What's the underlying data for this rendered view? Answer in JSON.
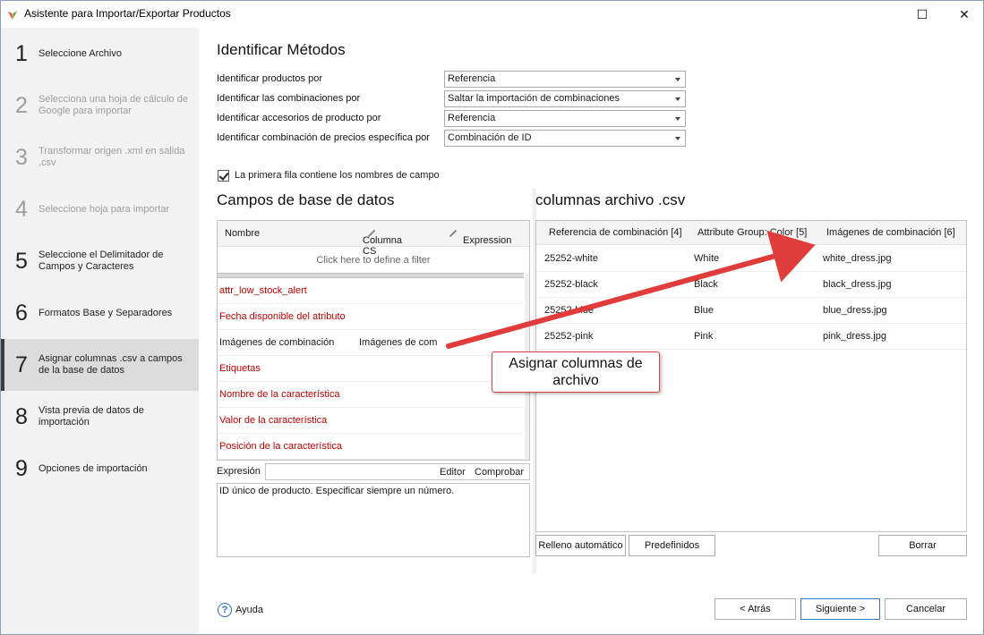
{
  "window": {
    "title": "Asistente para Importar/Exportar Productos",
    "maximize_glyph": "☐",
    "close_glyph": "✕"
  },
  "steps": [
    {
      "num": "1",
      "label": "Seleccione Archivo",
      "state": "enabled"
    },
    {
      "num": "2",
      "label": "Selecciona una hoja de cálculo de Google para importar",
      "state": "disabled"
    },
    {
      "num": "3",
      "label": "Transformar origen .xml en salida .csv",
      "state": "disabled"
    },
    {
      "num": "4",
      "label": "Seleccione hoja para importar",
      "state": "disabled"
    },
    {
      "num": "5",
      "label": "Seleccione el Delimitador de Campos y Caracteres",
      "state": "enabled"
    },
    {
      "num": "6",
      "label": "Formatos Base y Separadores",
      "state": "enabled"
    },
    {
      "num": "7",
      "label": "Asignar columnas .csv a campos de la base de datos",
      "state": "active"
    },
    {
      "num": "8",
      "label": "Vista previa de datos de importación",
      "state": "enabled"
    },
    {
      "num": "9",
      "label": "Opciones de importación",
      "state": "enabled"
    }
  ],
  "identify": {
    "title": "Identificar Métodos",
    "rows": [
      {
        "label": "Identificar productos por",
        "value": "Referencia"
      },
      {
        "label": "Identificar las combinaciones por",
        "value": "Saltar la importación de combinaciones"
      },
      {
        "label": "Identificar accesorios de producto por",
        "value": "Referencia"
      },
      {
        "label": "Identificar combinación de precios específica por",
        "value": "Combinación de ID"
      }
    ]
  },
  "first_row_checkbox": {
    "label": "La primera fila contiene los nombres de campo",
    "checked": true
  },
  "db_fields": {
    "title": "Campos de base de datos",
    "headers": {
      "name": "Nombre",
      "csv_column": "Columna CS",
      "expression": "Expression"
    },
    "filter_text": "Click here to define a filter",
    "rows": [
      {
        "name": "attr_low_stock_alert",
        "column": "",
        "required": true
      },
      {
        "name": "Fecha disponible del atributo",
        "column": "",
        "required": true
      },
      {
        "name": "Imágenes de combinación",
        "column": "Imágenes de com",
        "required": false
      },
      {
        "name": "Etiquetas",
        "column": "",
        "required": true
      },
      {
        "name": "Nombre de la característica",
        "column": "",
        "required": true
      },
      {
        "name": "Valor de la característica",
        "column": "",
        "required": true
      },
      {
        "name": "Posición de la característica",
        "column": "",
        "required": true
      }
    ]
  },
  "expression": {
    "label": "Expresión",
    "editor": "Editor",
    "check": "Comprobar",
    "description": "ID único de producto. Especificar siempre un número."
  },
  "csv_columns": {
    "title": "columnas archivo .csv",
    "headers": [
      "Referencia de combinación [4]",
      "Attribute Group: Color [5]",
      "Imágenes de combinación [6]"
    ],
    "rows": [
      [
        "25252-white",
        "White",
        "white_dress.jpg"
      ],
      [
        "25252-black",
        "Black",
        "black_dress.jpg"
      ],
      [
        "25252-blue",
        "Blue",
        "blue_dress.jpg"
      ],
      [
        "25252-pink",
        "Pink",
        "pink_dress.jpg"
      ]
    ]
  },
  "buttons": {
    "autofill": "Relleno automático",
    "presets": "Predefinidos",
    "clear": "Borrar",
    "back": "< Atrás",
    "next": "Siguiente >",
    "cancel": "Cancelar",
    "help": "Ayuda"
  },
  "annotation": {
    "text": "Asignar columnas de archivo",
    "color": "#e03c3c"
  }
}
